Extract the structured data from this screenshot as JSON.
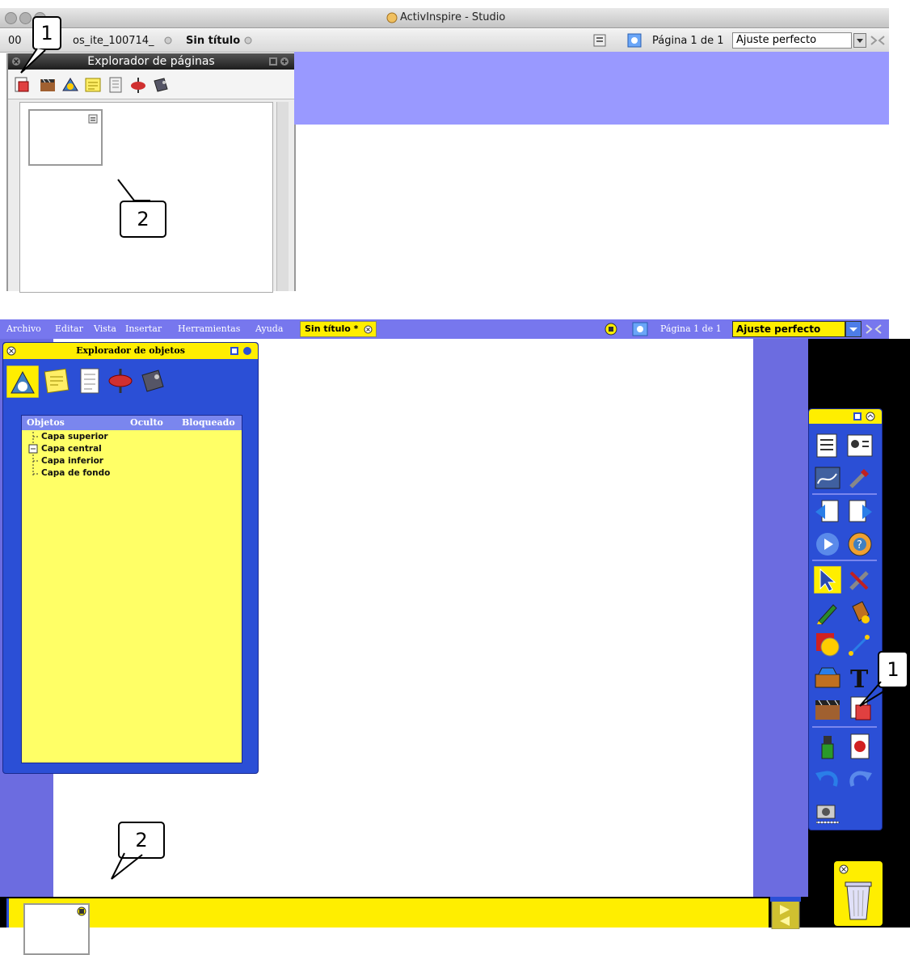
{
  "studio": {
    "window_title": "ActivInspire - Studio",
    "tabs": [
      {
        "label": "00"
      },
      {
        "label": "os_ite_100714_"
      },
      {
        "label": "Sin título"
      }
    ],
    "page_info": "Página 1 de 1",
    "zoom_value": "Ajuste perfecto",
    "page_explorer": {
      "title": "Explorador de páginas"
    },
    "callout_1": "1",
    "callout_2": "2"
  },
  "primary": {
    "menu": [
      "Archivo",
      "Editar",
      "Vista",
      "Insertar",
      "Herramientas",
      "Ayuda"
    ],
    "doc_tab": "Sin título *",
    "page_info": "Página 1 de 1",
    "zoom_value": "Ajuste perfecto",
    "object_explorer": {
      "title": "Explorador de objetos",
      "columns": [
        "Objetos",
        "Oculto",
        "Bloqueado"
      ],
      "layers": [
        "Capa superior",
        "Capa central",
        "Capa inferior",
        "Capa de fondo"
      ]
    },
    "callout_1": "1",
    "callout_2": "2"
  },
  "colors": {
    "studio_canvas": "#9999ff",
    "primary_menubar": "#7777ee",
    "primary_panel": "#2b4fd6",
    "primary_yellow": "#ffee00"
  }
}
